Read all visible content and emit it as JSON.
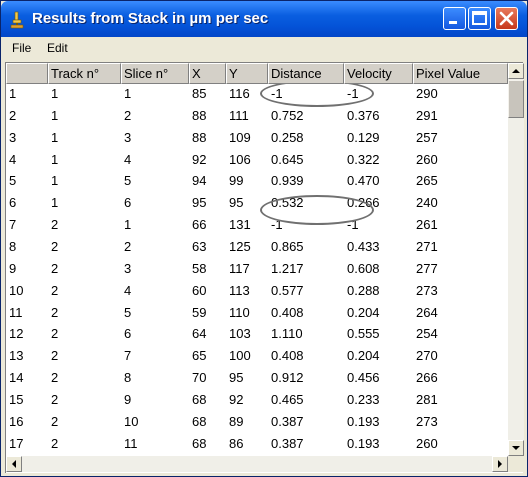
{
  "window": {
    "title": "Results from Stack in µm per sec",
    "menu": [
      "File",
      "Edit"
    ]
  },
  "table": {
    "columns": [
      "",
      "Track n°",
      "Slice n°",
      "X",
      "Y",
      "Distance",
      "Velocity",
      "Pixel Value"
    ],
    "rows": [
      [
        "1",
        "1",
        "1",
        "85",
        "116",
        "-1",
        "-1",
        "290"
      ],
      [
        "2",
        "1",
        "2",
        "88",
        "111",
        "0.752",
        "0.376",
        "291"
      ],
      [
        "3",
        "1",
        "3",
        "88",
        "109",
        "0.258",
        "0.129",
        "257"
      ],
      [
        "4",
        "1",
        "4",
        "92",
        "106",
        "0.645",
        "0.322",
        "260"
      ],
      [
        "5",
        "1",
        "5",
        "94",
        "99",
        "0.939",
        "0.470",
        "265"
      ],
      [
        "6",
        "1",
        "6",
        "95",
        "95",
        "0.532",
        "0.266",
        "240"
      ],
      [
        "7",
        "2",
        "1",
        "66",
        "131",
        "-1",
        "-1",
        "261"
      ],
      [
        "8",
        "2",
        "2",
        "63",
        "125",
        "0.865",
        "0.433",
        "271"
      ],
      [
        "9",
        "2",
        "3",
        "58",
        "117",
        "1.217",
        "0.608",
        "277"
      ],
      [
        "10",
        "2",
        "4",
        "60",
        "113",
        "0.577",
        "0.288",
        "273"
      ],
      [
        "11",
        "2",
        "5",
        "59",
        "110",
        "0.408",
        "0.204",
        "264"
      ],
      [
        "12",
        "2",
        "6",
        "64",
        "103",
        "1.110",
        "0.555",
        "254"
      ],
      [
        "13",
        "2",
        "7",
        "65",
        "100",
        "0.408",
        "0.204",
        "270"
      ],
      [
        "14",
        "2",
        "8",
        "70",
        "95",
        "0.912",
        "0.456",
        "266"
      ],
      [
        "15",
        "2",
        "9",
        "68",
        "92",
        "0.465",
        "0.233",
        "281"
      ],
      [
        "16",
        "2",
        "10",
        "68",
        "89",
        "0.387",
        "0.193",
        "273"
      ],
      [
        "17",
        "2",
        "11",
        "68",
        "86",
        "0.387",
        "0.193",
        "260"
      ]
    ]
  },
  "colors": {
    "titlebar": "#0453d8",
    "close_button": "#c6381b",
    "header_bg": "#d4d0c8",
    "annotation_ellipse": "#707070"
  },
  "icons": [
    "microscope-icon",
    "minimize-icon",
    "maximize-icon",
    "close-icon",
    "scroll-up-arrow-icon",
    "scroll-down-arrow-icon",
    "scroll-left-arrow-icon",
    "scroll-right-arrow-icon"
  ]
}
